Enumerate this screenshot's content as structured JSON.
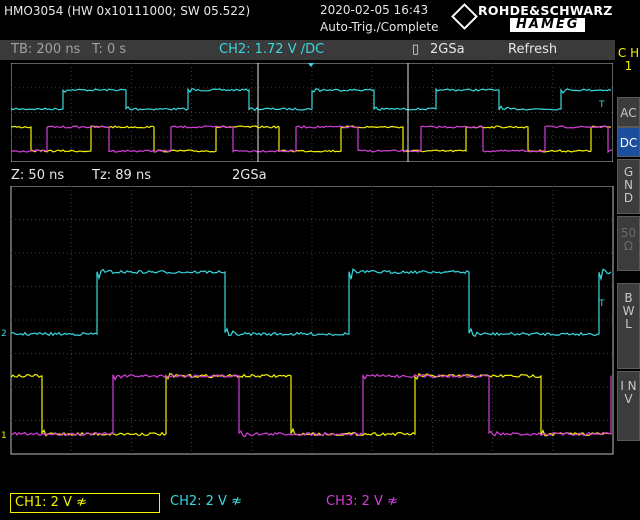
{
  "header": {
    "model": "HMO3054 (HW 0x10111000; SW 05.522)",
    "datetime": "2020-02-05 16:43",
    "trigger_status": "Auto-Trig./Complete",
    "brand_top": "ROHDE&SCHWARZ",
    "brand_bottom": "HAMEG"
  },
  "status": {
    "timebase": "TB: 200 ns",
    "trigger_time": "T: 0 s",
    "trigger_source": "CH2: 1.72 V ∕DC",
    "sample_rate": "2GSa",
    "mode": "Refresh"
  },
  "zoom": {
    "zoom": "Z: 50 ns",
    "tz": "Tz: 89 ns",
    "sample_rate": "2GSa"
  },
  "channels": [
    {
      "label": "CH1: 2 V ≉",
      "color": "#f2f200"
    },
    {
      "label": "CH2: 2 V ≉",
      "color": "#38d8de"
    },
    {
      "label": "CH3: 2 V ≉",
      "color": "#d43fd8"
    }
  ],
  "sidebar": {
    "channel": "C H 1",
    "buttons": [
      "AC",
      "DC",
      "G N D",
      "50 Ω",
      "B W L",
      "I N V"
    ]
  },
  "markers": {
    "trigger_level": "T",
    "ch2_ref": "2",
    "ch1_ref": "1"
  },
  "colors": {
    "ch1": "#f2f200",
    "ch2": "#38d8de",
    "ch3": "#d43fd8"
  }
}
